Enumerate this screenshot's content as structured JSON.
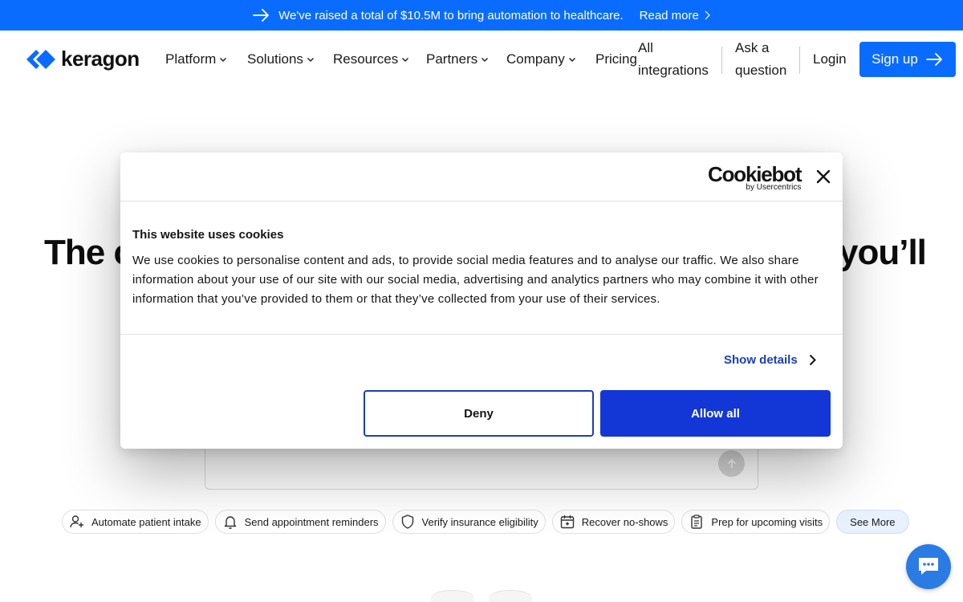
{
  "announcement": {
    "message": "We've raised a total of $10.5M to bring automation to healthcare.",
    "link": "Read more"
  },
  "nav": {
    "logo_text": "keragon",
    "menu": [
      "Platform",
      "Solutions",
      "Resources",
      "Partners",
      "Company"
    ],
    "pricing": "Pricing",
    "integrations": [
      "All",
      "integrations"
    ],
    "ask": [
      "Ask a",
      "question"
    ],
    "login": "Login",
    "signup": "Sign up"
  },
  "hero": {
    "left_fragment": "The c",
    "right_fragment": "you’ll"
  },
  "chips": [
    {
      "label": "Automate patient intake",
      "icon": "user-plus-icon"
    },
    {
      "label": "Send appointment reminders",
      "icon": "bell-icon"
    },
    {
      "label": "Verify insurance eligibility",
      "icon": "shield-icon"
    },
    {
      "label": "Recover no-shows",
      "icon": "calendar-icon"
    },
    {
      "label": "Prep for upcoming visits",
      "icon": "clipboard-icon"
    }
  ],
  "see_more": "See More",
  "cookie": {
    "brand": "Cookiebot",
    "brand_sub": "by Usercentrics",
    "title": "This website uses cookies",
    "body": "We use cookies to personalise content and ads, to provide social media features and to analyse our traffic. We also share information about your use of our site with our social media, advertising and analytics partners who may combine it with other information that you’ve provided to them or that they’ve collected from your use of their services.",
    "show_details": "Show details",
    "deny": "Deny",
    "allow_all": "Allow all"
  },
  "colors": {
    "brand_blue": "#0a6cff",
    "cookie_blue": "#1237d6",
    "link_blue": "#1a3fb8"
  }
}
